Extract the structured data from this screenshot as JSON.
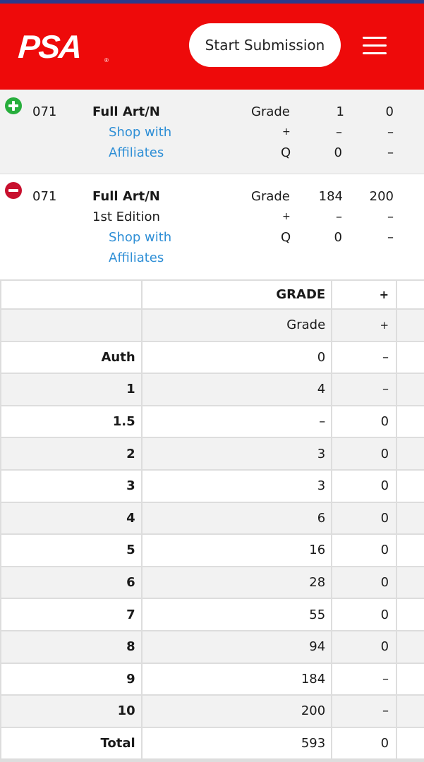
{
  "header": {
    "logo_text": "PSA",
    "logo_mark": "®",
    "start_button": "Start Submission",
    "menu_icon": "hamburger-menu-icon",
    "brand_color": "#ee0a0a"
  },
  "pop_rows": [
    {
      "expand_icon": "plus-circle-icon",
      "number": "071",
      "name": "Full Art/N",
      "variety": "",
      "link_line1": "Shop with",
      "link_line2": "Affiliates",
      "labels": [
        "Grade",
        "+",
        "Q"
      ],
      "col1": [
        "1",
        "–",
        "0"
      ],
      "col2": [
        "0",
        "–",
        "–"
      ]
    },
    {
      "expand_icon": "minus-circle-icon",
      "number": "071",
      "name": "Full Art/N",
      "variety": "1st Edition",
      "link_line1": "Shop with",
      "link_line2": "Affiliates",
      "labels": [
        "Grade",
        "+",
        "Q"
      ],
      "col1": [
        "184",
        "–",
        "0"
      ],
      "col2": [
        "200",
        "–",
        "–"
      ]
    }
  ],
  "table": {
    "header": [
      "",
      "GRADE",
      "+"
    ],
    "subheader": [
      "",
      "Grade",
      "+"
    ],
    "rows": [
      [
        "Auth",
        "0",
        "–"
      ],
      [
        "1",
        "4",
        "–"
      ],
      [
        "1.5",
        "–",
        "0"
      ],
      [
        "2",
        "3",
        "0"
      ],
      [
        "3",
        "3",
        "0"
      ],
      [
        "4",
        "6",
        "0"
      ],
      [
        "5",
        "16",
        "0"
      ],
      [
        "6",
        "28",
        "0"
      ],
      [
        "7",
        "55",
        "0"
      ],
      [
        "8",
        "94",
        "0"
      ],
      [
        "9",
        "184",
        "–"
      ],
      [
        "10",
        "200",
        "–"
      ],
      [
        "Total",
        "593",
        "0"
      ]
    ]
  }
}
